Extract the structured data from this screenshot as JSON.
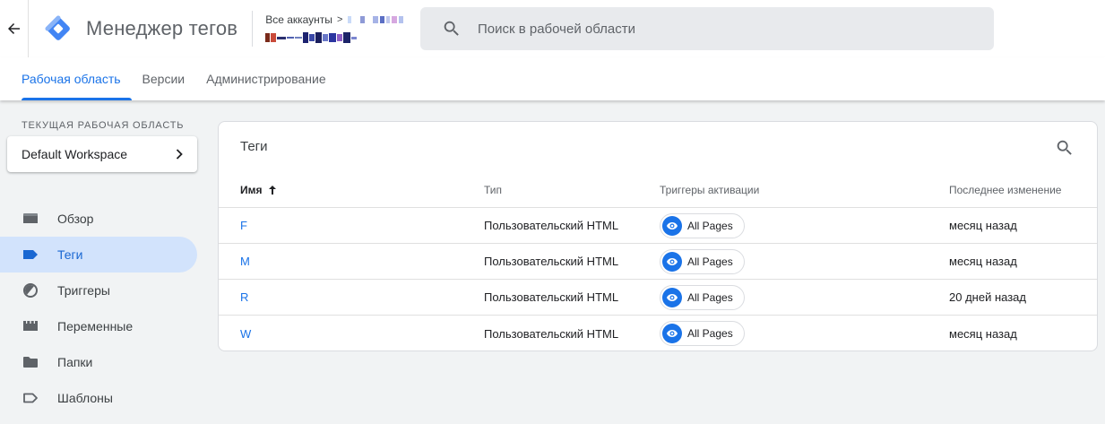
{
  "header": {
    "app_title": "Менеджер тегов",
    "accounts_crumb": "Все аккаунты",
    "crumb_separator": ">",
    "search_placeholder": "Поиск в рабочей области"
  },
  "tabs": [
    {
      "label": "Рабочая область",
      "active": true
    },
    {
      "label": "Версии",
      "active": false
    },
    {
      "label": "Администрирование",
      "active": false
    }
  ],
  "sidebar": {
    "workspace_label": "ТЕКУЩАЯ РАБОЧАЯ ОБЛАСТЬ",
    "workspace_name": "Default Workspace",
    "items": [
      {
        "label": "Обзор",
        "icon": "overview-icon",
        "active": false
      },
      {
        "label": "Теги",
        "icon": "tag-icon",
        "active": true
      },
      {
        "label": "Триггеры",
        "icon": "trigger-icon",
        "active": false
      },
      {
        "label": "Переменные",
        "icon": "variables-icon",
        "active": false
      },
      {
        "label": "Папки",
        "icon": "folder-icon",
        "active": false
      },
      {
        "label": "Шаблоны",
        "icon": "template-icon",
        "active": false
      }
    ]
  },
  "tags_card": {
    "title": "Теги",
    "columns": [
      "Имя",
      "Тип",
      "Триггеры активации",
      "Последнее изменение"
    ],
    "rows": [
      {
        "name": "F",
        "type": "Пользовательский HTML",
        "trigger": "All Pages",
        "modified": "месяц назад"
      },
      {
        "name": "M",
        "type": "Пользовательский HTML",
        "trigger": "All Pages",
        "modified": "месяц назад"
      },
      {
        "name": "R",
        "type": "Пользовательский HTML",
        "trigger": "All Pages",
        "modified": "20 дней назад"
      },
      {
        "name": "W",
        "type": "Пользовательский HTML",
        "trigger": "All Pages",
        "modified": "месяц назад"
      }
    ]
  },
  "colors": {
    "accent": "#1a73e8",
    "active_nav_bg": "#d2e3fc",
    "page_bg": "#f1f3f4"
  }
}
